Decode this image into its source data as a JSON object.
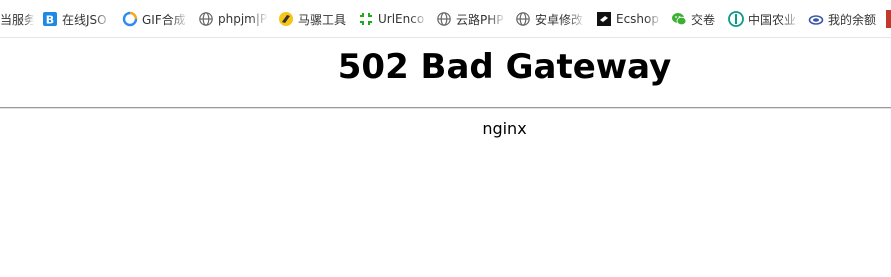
{
  "bookmarks_bar": {
    "items": [
      {
        "label": "当服务",
        "icon": "none"
      },
      {
        "label": "在线JSO",
        "icon": "json-b-icon"
      },
      {
        "label": "GIF合成",
        "icon": "gif-icon"
      },
      {
        "label": "phpjm|P",
        "icon": "globe-icon"
      },
      {
        "label": "马骡工具",
        "icon": "mule-icon"
      },
      {
        "label": "UrlEnco",
        "icon": "url-icon"
      },
      {
        "label": "云路PHP",
        "icon": "globe-icon"
      },
      {
        "label": "安卓修改",
        "icon": "globe-icon"
      },
      {
        "label": "Ecshop",
        "icon": "ecshop-icon"
      },
      {
        "label": "交卷",
        "icon": "wechat-icon"
      },
      {
        "label": "中国农业",
        "icon": "abc-bank-icon"
      },
      {
        "label": "我的余额",
        "icon": "cloud-icon"
      }
    ]
  },
  "page": {
    "title": "502 Bad Gateway",
    "server": "nginx"
  },
  "colors": {
    "json_icon": "#1e88e5",
    "gif_icon_blue": "#2d8cf0",
    "gif_icon_orange": "#f5a623",
    "globe_icon": "#666666",
    "mule_icon": "#f5c518",
    "url_icon": "#1aad19",
    "ecshop_icon": "#111111",
    "wechat_icon": "#3cb034",
    "abc_icon": "#0a9a8a",
    "cloud_icon": "#3a56a6",
    "edge_red": "#c0392b"
  }
}
